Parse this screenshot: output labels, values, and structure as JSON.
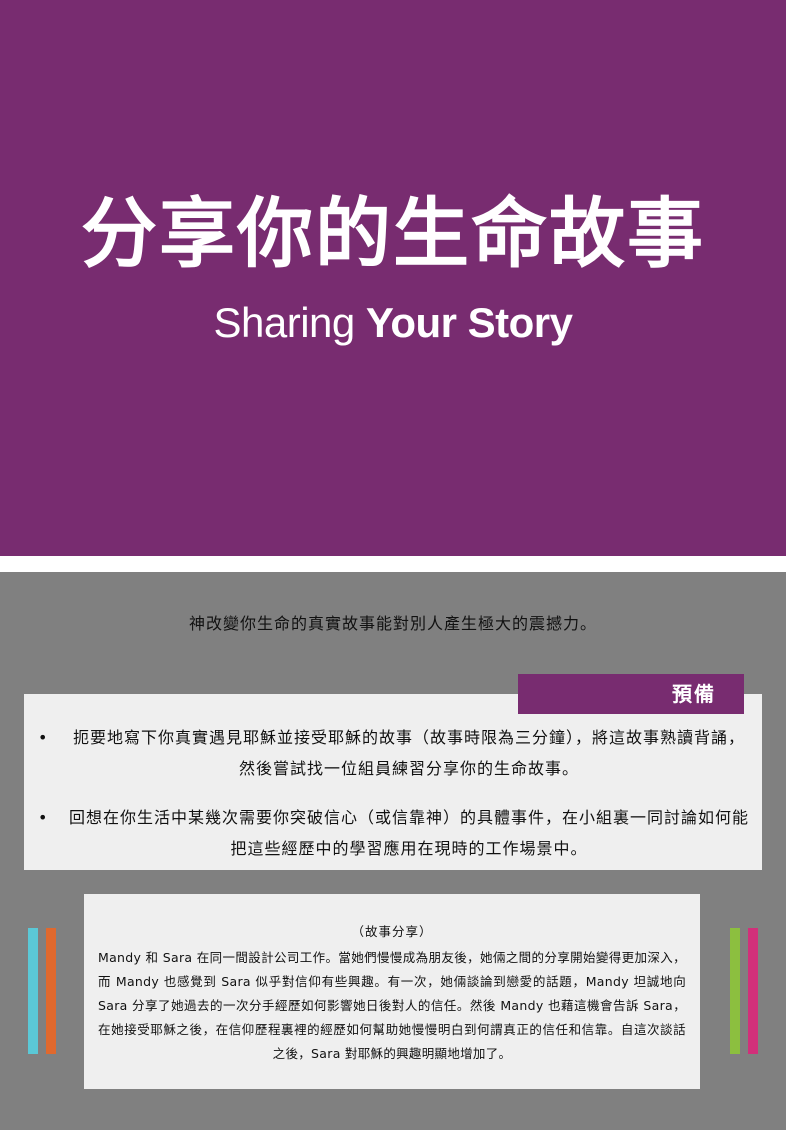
{
  "hero": {
    "title_zh": "分享你的生命故事",
    "subtitle_regular": "Sharing",
    "subtitle_bold": "Your Story"
  },
  "intro": "神改變你生命的真實故事能對別人產生極大的震撼力。",
  "prep": {
    "tag": "預備",
    "bullets": [
      {
        "line1": "扼要地寫下你真實遇見耶穌並接受耶穌的故事（故事時限為三分鐘），將這故事熟讀背誦，",
        "line2": "然後嘗試找一位組員練習分享你的生命故事。"
      },
      {
        "line1": "回想在你生活中某幾次需要你突破信心（或信靠神）的具體事件，在小組裏一同討論如何能",
        "line2": "把這些經歷中的學習應用在現時的工作場景中。"
      }
    ]
  },
  "story": {
    "heading": "（故事分享）",
    "body": "Mandy 和 Sara 在同一間設計公司工作。當她們慢慢成為朋友後，她倆之間的分享開始變得更加深入，而 Mandy 也感覺到 Sara 似乎對信仰有些興趣。有一次，她倆談論到戀愛的話題，Mandy 坦誠地向 Sara 分享了她過去的一次分手經歷如何影響她日後對人的信任。然後 Mandy 也藉這機會告訴 Sara，在她接受耶穌之後，在信仰歷程裏裡的經歷如何幫助她慢慢明白到何謂真正的信任和信靠。自這次談話之後，Sara 對耶穌的興趣明顯地增加了。"
  },
  "colors": {
    "purple": "#782c70",
    "grey": "#808080",
    "light": "#efefef",
    "bar_cyan": "#5bc8d6",
    "bar_orange": "#e0692e",
    "bar_green": "#8cbf3f",
    "bar_magenta": "#d1307a"
  }
}
